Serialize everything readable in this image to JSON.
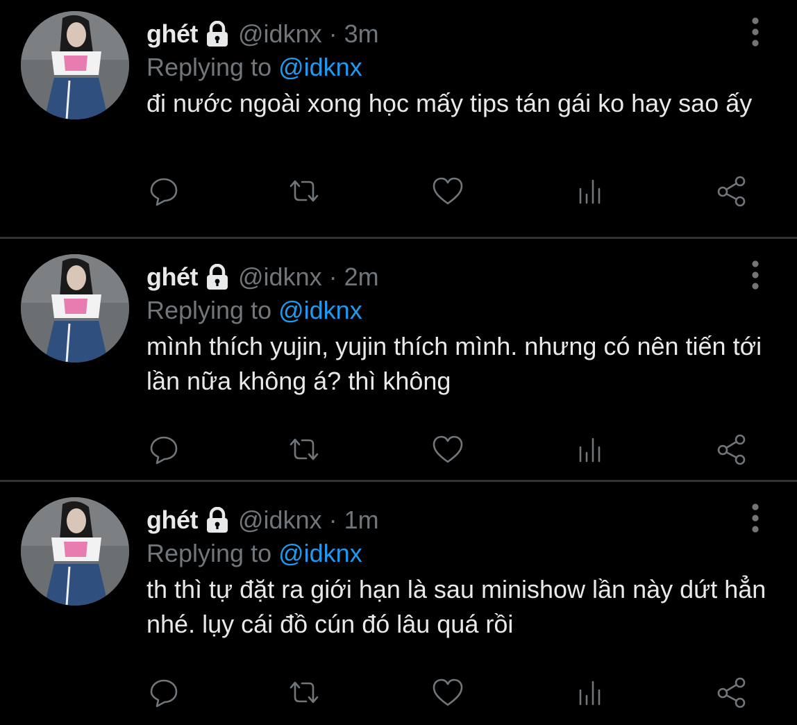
{
  "colors": {
    "background": "#000000",
    "text_primary": "#e7e9ea",
    "text_secondary": "#71767b",
    "mention": "#1d9bf0",
    "divider": "#2f3336"
  },
  "icons": {
    "lock": "lock-icon",
    "more": "more-vertical-icon",
    "reply": "reply-bubble-icon",
    "retweet": "retweet-icon",
    "like": "heart-icon",
    "analytics": "analytics-icon",
    "share": "share-icon"
  },
  "tweets": [
    {
      "display_name": "ghét",
      "handle": "@idknx",
      "separator": "·",
      "time": "3m",
      "replying_prefix": "Replying to ",
      "replying_to": "@idknx",
      "text": "đi nước ngoài xong học mấy tips tán gái ko hay sao ấy"
    },
    {
      "display_name": "ghét",
      "handle": "@idknx",
      "separator": "·",
      "time": "2m",
      "replying_prefix": "Replying to ",
      "replying_to": "@idknx",
      "text": "mình thích yujin, yujin thích mình. nhưng có nên tiến tới lần nữa không á? thì không"
    },
    {
      "display_name": "ghét",
      "handle": "@idknx",
      "separator": "·",
      "time": "1m",
      "replying_prefix": "Replying to ",
      "replying_to": "@idknx",
      "text": "th thì tự đặt ra giới hạn là sau minishow lần này dứt hẳn nhé. lụy cái đồ cún đó lâu quá rồi"
    }
  ]
}
